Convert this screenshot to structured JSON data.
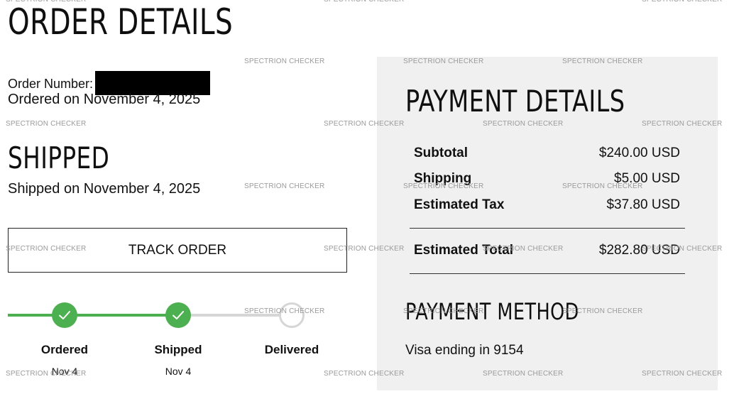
{
  "order": {
    "title": "ORDER DETAILS",
    "number_label": "Order Number:",
    "ordered_on": "Ordered on November 4, 2025",
    "status_heading": "SHIPPED",
    "shipped_on": "Shipped on November 4, 2025",
    "track_button_label": "TRACK ORDER"
  },
  "tracker": {
    "progress_completed_steps": 2,
    "steps": [
      {
        "label": "Ordered",
        "date": "Nov 4",
        "status": "complete"
      },
      {
        "label": "Shipped",
        "date": "Nov 4",
        "status": "complete"
      },
      {
        "label": "Delivered",
        "date": "",
        "status": "pending"
      }
    ]
  },
  "payment": {
    "title": "PAYMENT DETAILS",
    "rows": [
      {
        "label": "Subtotal",
        "value": "$240.00 USD"
      },
      {
        "label": "Shipping",
        "value": "$5.00 USD"
      },
      {
        "label": "Estimated Tax",
        "value": "$37.80 USD"
      }
    ],
    "total": {
      "label": "Estimated Total",
      "value": "$282.80 USD"
    },
    "method_title": "PAYMENT METHOD",
    "method_value": "Visa ending in 9154"
  },
  "watermark": {
    "text": "SPECTRION CHECKER"
  },
  "colors": {
    "progress_complete": "#4caf50",
    "progress_pending": "#d6d6d6",
    "panel_background": "#f0f0f0",
    "redaction": "#000000"
  },
  "icons": {
    "step_complete": "check-icon",
    "step_pending": "empty-circle-icon"
  }
}
